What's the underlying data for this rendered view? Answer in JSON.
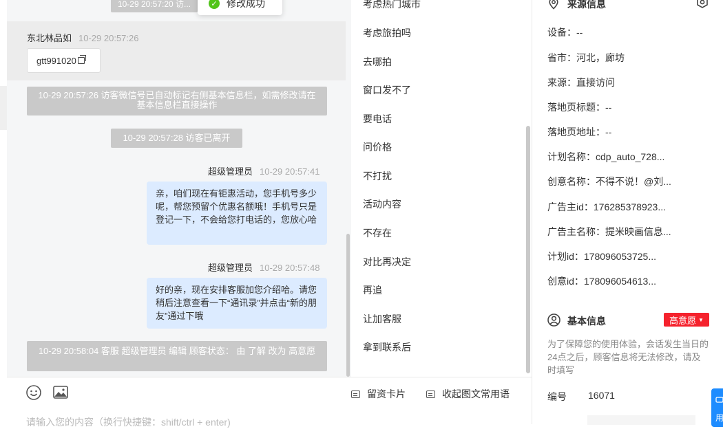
{
  "toast": {
    "text": "修改成功"
  },
  "chat": {
    "top_system_partial": "10-29 20:57:20 访...",
    "visitor": {
      "name": "东北林品如",
      "time": "10-29 20:57:26",
      "card_text": "gtt991020"
    },
    "system_wechat": "10-29 20:57:26 访客微信号已自动标记右侧基本信息栏，如需修改请在基本信息栏直接操作",
    "system_left": "10-29 20:57:28 访客已离开",
    "messages": [
      {
        "sender": "超级管理员",
        "time": "10-29 20:57:41",
        "text": "亲，咱们现在有钜惠活动，您手机号多少呢，帮您预留个优惠名额哦！手机号只是登记一下，不会给您打电话的，您放心哈"
      },
      {
        "sender": "超级管理员",
        "time": "10-29 20:57:48",
        "text": "好的亲，现在安排客服加您介绍哈。请您稍后注意查看一下“通讯录”并点击“新的朋友”通过下哦"
      }
    ],
    "system_status": "10-29 20:58:04 客服 超级管理员 编辑 顾客状态： 由 了解 改为 高意愿"
  },
  "input": {
    "placeholder": "请输入您的内容（换行快捷键：shift/ctrl + enter)",
    "card_button": "留资卡片",
    "collapse_button": "收起图文常用语"
  },
  "quick_replies": [
    "考虑热门城市",
    "考虑旅拍吗",
    "去哪拍",
    "窗口发不了",
    "要电话",
    "问价格",
    "不打扰",
    "活动内容",
    "不存在",
    "对比再决定",
    "再追",
    "让加客服",
    "拿到联系后"
  ],
  "source_info": {
    "title": "来源信息",
    "rows": [
      "设备：--",
      "省市：河北，廊坊",
      "来源：直接访问",
      "落地页标题：--",
      "落地页地址：--",
      "计划名称：cdp_auto_728...",
      "创意名称：不得不说！@刘...",
      "广告主id：176285378923...",
      "广告主名称：提米映画信息...",
      "计划id：178096053725...",
      "创意id：178096054613..."
    ]
  },
  "basic_info": {
    "title": "基本信息",
    "badge": "高意愿",
    "note": "为了保障您的使用体验，会话发生当日的24点之后，顾客信息将无法修改，请及时填写",
    "id_label": "编号",
    "id_value": "16071"
  },
  "float_button": {
    "label": "用"
  },
  "colors": {
    "accent": "#1e8cff",
    "badge": "#f5222d",
    "bubble": "#dcebff",
    "system": "#c9c9c9",
    "success": "#52c41a"
  }
}
